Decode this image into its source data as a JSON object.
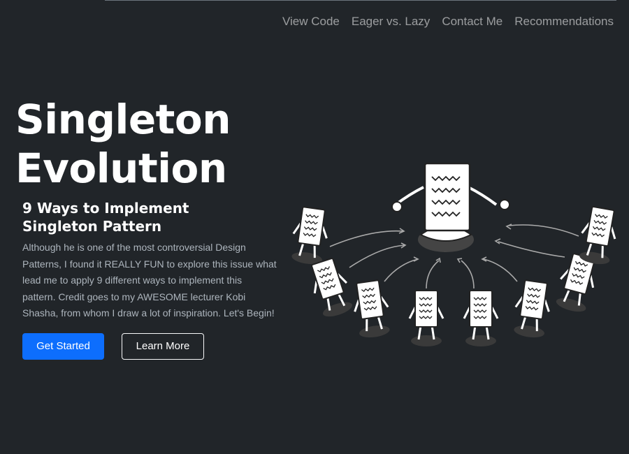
{
  "nav": {
    "items": [
      "View Code",
      "Eager vs. Lazy",
      "Contact Me",
      "Recommendations"
    ]
  },
  "hero": {
    "title_line1": "Singleton",
    "title_line2": "Evolution",
    "subtitle_line1": "9 Ways to Implement",
    "subtitle_line2": "Singleton Pattern",
    "lead": "Although he is one of the most controversial Design Patterns, I found it REALLY FUN to explore this issue what lead me to apply 9 different ways to implement this pattern. Credit goes to my AWESOME lecturer Kobi Shasha, from whom I draw a lot of inspiration. Let's Begin!",
    "primary_button": "Get Started",
    "secondary_button": "Learn More"
  },
  "colors": {
    "background": "#212529",
    "primary": "#0d6efd",
    "muted_text": "#adb5bd"
  },
  "icons": {
    "illustration": "meditating-document-characters-illustration"
  }
}
